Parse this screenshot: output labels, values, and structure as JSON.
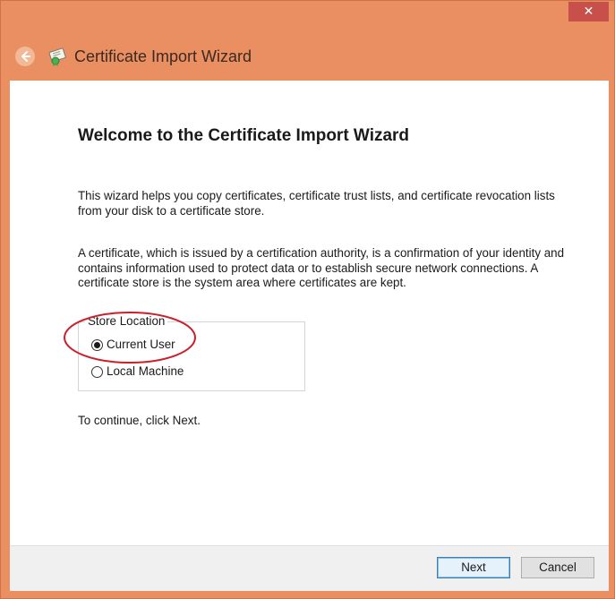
{
  "window": {
    "title": "Certificate Import Wizard",
    "close_glyph": "✕",
    "accent_color": "#ea8f62"
  },
  "header": {
    "back_icon": "back-arrow-icon",
    "app_icon": "certificate-icon"
  },
  "main": {
    "heading": "Welcome to the Certificate Import Wizard",
    "paragraph1": "This wizard helps you copy certificates, certificate trust lists, and certificate revocation lists from your disk to a certificate store.",
    "paragraph2": "A certificate, which is issued by a certification authority, is a confirmation of your identity and contains information used to protect data or to establish secure network connections. A certificate store is the system area where certificates are kept.",
    "store_location": {
      "legend": "Store Location",
      "options": [
        {
          "label": "Current User",
          "selected": true
        },
        {
          "label": "Local Machine",
          "selected": false
        }
      ]
    },
    "continue_text": "To continue, click Next.",
    "annotation_color": "#cc1f2b"
  },
  "footer": {
    "next_label": "Next",
    "cancel_label": "Cancel"
  }
}
